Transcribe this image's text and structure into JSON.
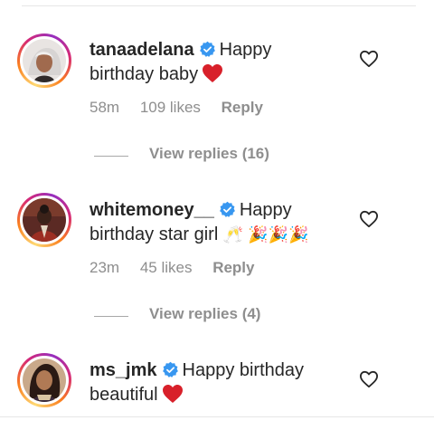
{
  "comments": [
    {
      "username": "tanaadelana",
      "text_line1": "Happy",
      "text_line2": "birthday baby",
      "time": "58m",
      "likes": "109 likes",
      "reply_label": "Reply",
      "view_replies": "View replies (16)"
    },
    {
      "username": "whitemoney__",
      "text_line1": "Happy",
      "text_line2": "birthday star girl",
      "emojis": "🥂 🎉🎉🎉",
      "time": "23m",
      "likes": "45 likes",
      "reply_label": "Reply",
      "view_replies": "View replies (4)"
    },
    {
      "username": "ms_jmk",
      "text_line1": "Happy birthday",
      "text_line2": "beautiful"
    }
  ],
  "colors": {
    "verified": "#3897f0",
    "heart": "#ed1c24",
    "muted": "#8e8e8e",
    "text": "#262626"
  },
  "icons": [
    "verified-badge-icon",
    "red-heart-icon",
    "like-heart-outline-icon"
  ]
}
